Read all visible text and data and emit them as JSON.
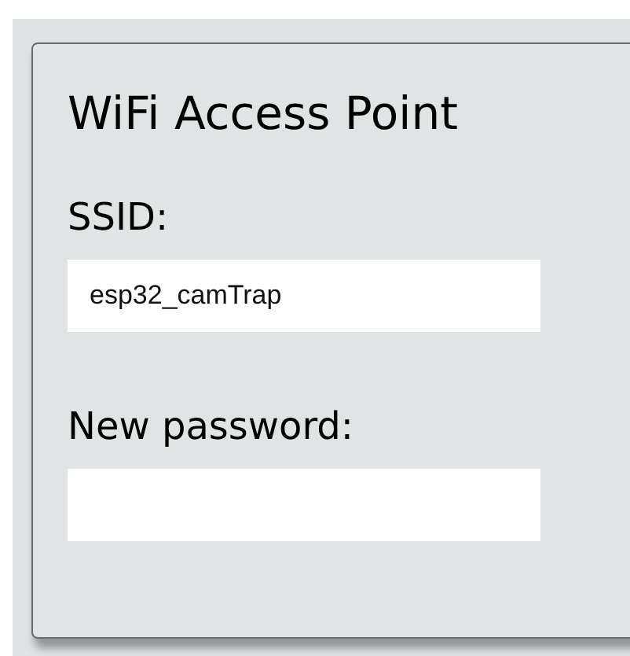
{
  "panel": {
    "title": "WiFi Access Point",
    "fields": [
      {
        "label": "SSID:",
        "value": "esp32_camTrap"
      },
      {
        "label": "New password:"
      }
    ]
  }
}
